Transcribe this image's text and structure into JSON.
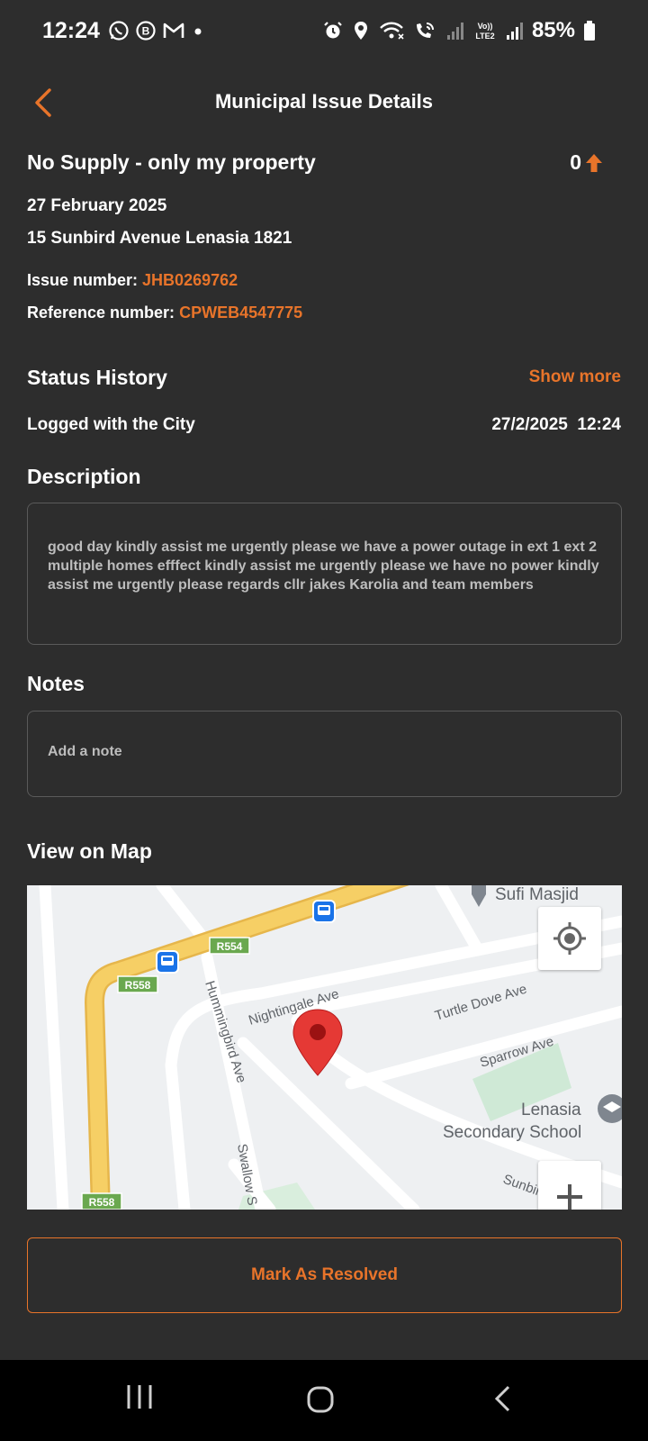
{
  "status_bar": {
    "time": "12:24",
    "left_icons": [
      "whatsapp-icon",
      "b-badge-icon",
      "gmail-icon",
      "dot-icon"
    ],
    "right_icons": [
      "alarm-icon",
      "location-icon",
      "wifi-icon",
      "wifi-call-icon",
      "signal-icon",
      "volte-icon",
      "signal-icon"
    ],
    "volte_label": "Vo))\nLTE2",
    "battery": "85%"
  },
  "header": {
    "title": "Municipal Issue Details"
  },
  "issue": {
    "title": "No Supply - only my property",
    "votes": "0",
    "date": "27 February 2025",
    "address": "15 Sunbird Avenue Lenasia 1821",
    "issue_number_label": "Issue number:",
    "issue_number": "JHB0269762",
    "reference_number_label": "Reference number:",
    "reference_number": "CPWEB4547775"
  },
  "status_history": {
    "title": "Status History",
    "show_more": "Show more",
    "entries": [
      {
        "status": "Logged with the City",
        "timestamp": "27/2/2025  12:24"
      }
    ]
  },
  "description": {
    "title": "Description",
    "text": "good day kindly assist me urgently please we have a power outage in ext 1 ext 2 multiple homes efffect kindly assist me urgently please we have no power kindly assist me urgently please regards cllr jakes Karolia and team members"
  },
  "notes": {
    "title": "Notes",
    "placeholder": "Add a note"
  },
  "map": {
    "title": "View on Map",
    "labels": {
      "sufi_masjid": "Sufi Masjid",
      "r554": "R554",
      "r558_top": "R558",
      "r558_bottom": "R558",
      "nightingale": "Nightingale Ave",
      "hummingbird": "Hummingbird Ave",
      "turtle_dove": "Turtle Dove Ave",
      "sparrow": "Sparrow Ave",
      "lenasia": "Lenasia",
      "secondary_school": "Secondary School",
      "sunbird": "Sunbird Ave",
      "swallow": "Swallow S"
    },
    "colors": {
      "road_major": "#f6cf65",
      "road_minor": "#ffffff",
      "park": "#cfe9d6",
      "pin": "#e53935"
    }
  },
  "actions": {
    "resolve_label": "Mark As Resolved"
  },
  "theme": {
    "background": "#2d2d2d",
    "accent": "#e8742a",
    "text": "#ffffff"
  }
}
